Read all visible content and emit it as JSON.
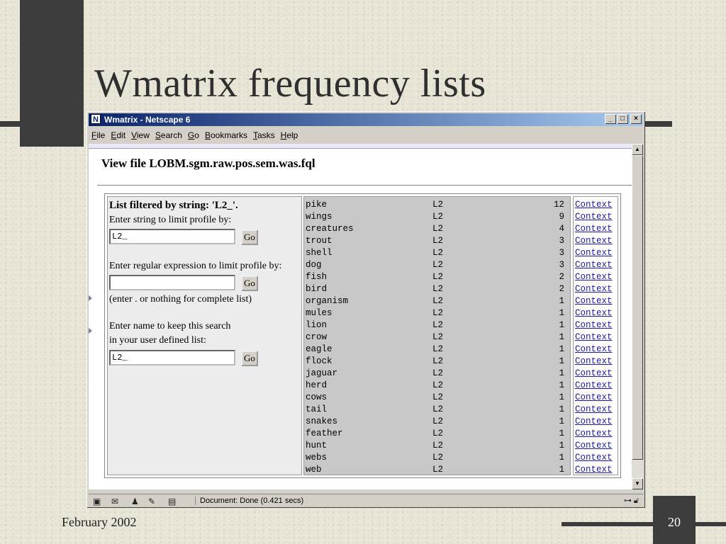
{
  "slide": {
    "title": "Wmatrix frequency lists",
    "footer_date": "February 2002",
    "page_number": "20"
  },
  "window": {
    "title": "Wmatrix - Netscape 6",
    "app_icon": "N",
    "controls": {
      "minimize": "_",
      "maximize": "□",
      "close": "×"
    },
    "menu": [
      "File",
      "Edit",
      "View",
      "Search",
      "Go",
      "Bookmarks",
      "Tasks",
      "Help"
    ]
  },
  "page": {
    "view_file": "View file LOBM.sgm.raw.pos.sem.was.fql",
    "filter_heading": "List filtered by string: 'L2_'.",
    "string_label": "Enter string to limit profile by:",
    "string_value": "L2_",
    "regex_label": "Enter regular expression to limit profile by:",
    "regex_value": "",
    "regex_hint": "(enter . or nothing for complete list)",
    "name_label_1": "Enter name to keep this search",
    "name_label_2": "in your user defined list:",
    "name_value": "L2_",
    "go_label": "Go",
    "context_label": "Context",
    "rows": [
      {
        "word": "pike",
        "tag": "L2",
        "freq": "12"
      },
      {
        "word": "wings",
        "tag": "L2",
        "freq": "9"
      },
      {
        "word": "creatures",
        "tag": "L2",
        "freq": "4"
      },
      {
        "word": "trout",
        "tag": "L2",
        "freq": "3"
      },
      {
        "word": "shell",
        "tag": "L2",
        "freq": "3"
      },
      {
        "word": "dog",
        "tag": "L2",
        "freq": "3"
      },
      {
        "word": "fish",
        "tag": "L2",
        "freq": "2"
      },
      {
        "word": "bird",
        "tag": "L2",
        "freq": "2"
      },
      {
        "word": "organism",
        "tag": "L2",
        "freq": "1"
      },
      {
        "word": "mules",
        "tag": "L2",
        "freq": "1"
      },
      {
        "word": "lion",
        "tag": "L2",
        "freq": "1"
      },
      {
        "word": "crow",
        "tag": "L2",
        "freq": "1"
      },
      {
        "word": "eagle",
        "tag": "L2",
        "freq": "1"
      },
      {
        "word": "flock",
        "tag": "L2",
        "freq": "1"
      },
      {
        "word": "jaguar",
        "tag": "L2",
        "freq": "1"
      },
      {
        "word": "herd",
        "tag": "L2",
        "freq": "1"
      },
      {
        "word": "cows",
        "tag": "L2",
        "freq": "1"
      },
      {
        "word": "tail",
        "tag": "L2",
        "freq": "1"
      },
      {
        "word": "snakes",
        "tag": "L2",
        "freq": "1"
      },
      {
        "word": "feather",
        "tag": "L2",
        "freq": "1"
      },
      {
        "word": "hunt",
        "tag": "L2",
        "freq": "1"
      },
      {
        "word": "webs",
        "tag": "L2",
        "freq": "1"
      },
      {
        "word": "web",
        "tag": "L2",
        "freq": "1"
      }
    ]
  },
  "statusbar": {
    "text": "Document: Done (0.421 secs)",
    "icons": [
      "navigator-icon",
      "mail-icon",
      "instant-messenger-icon",
      "composer-icon",
      "address-book-icon"
    ]
  },
  "colors": {
    "link": "#1a1aa8",
    "title_bar": "#0a246a",
    "list_bg": "#c8c8c8"
  }
}
